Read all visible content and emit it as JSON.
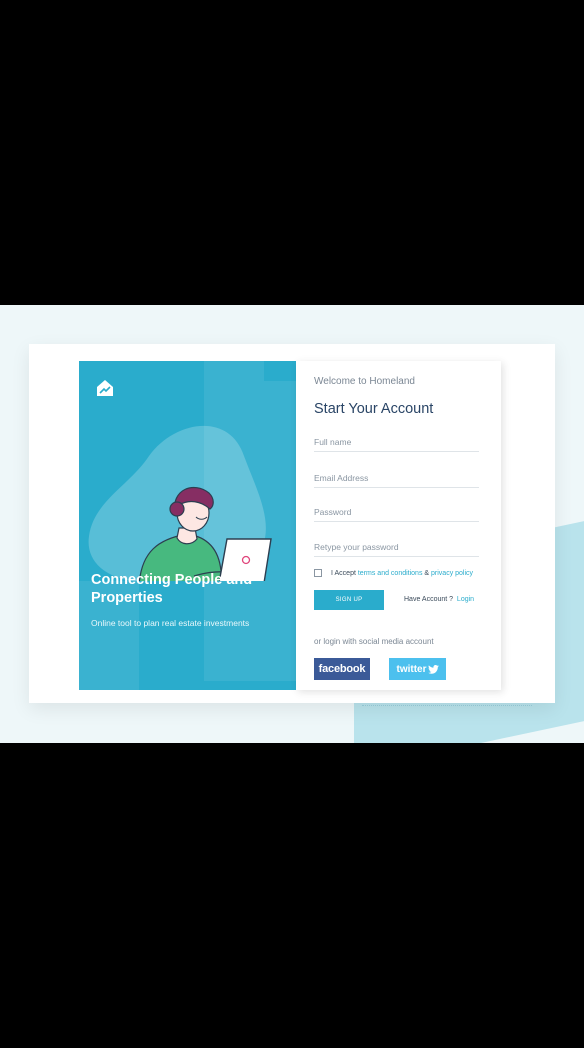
{
  "hero": {
    "headline": "Connecting People and Properties",
    "tagline": "Online tool to plan real estate investments",
    "logo_icon": "house-chart-icon",
    "colors": {
      "primary": "#2aaccc"
    }
  },
  "form": {
    "welcome": "Welcome to Homeland",
    "title": "Start Your Account",
    "fields": {
      "full_name": {
        "placeholder": "Full name",
        "value": ""
      },
      "email": {
        "placeholder": "Email Address",
        "value": ""
      },
      "password": {
        "placeholder": "Password",
        "value": ""
      },
      "retype": {
        "placeholder": "Retype your password",
        "value": ""
      }
    },
    "accept": {
      "prefix": "I Accept",
      "terms": "terms and conditions",
      "and": "&",
      "privacy": "privacy policy",
      "checked": false
    },
    "signup_label": "SIGN UP",
    "have_account": "Have Account ?",
    "login_label": "Login",
    "social_label": "or login with social media account",
    "facebook_label": "facebook",
    "twitter_label": "twitter",
    "colors": {
      "facebook": "#3b5a98",
      "twitter": "#4cc0ee"
    }
  }
}
